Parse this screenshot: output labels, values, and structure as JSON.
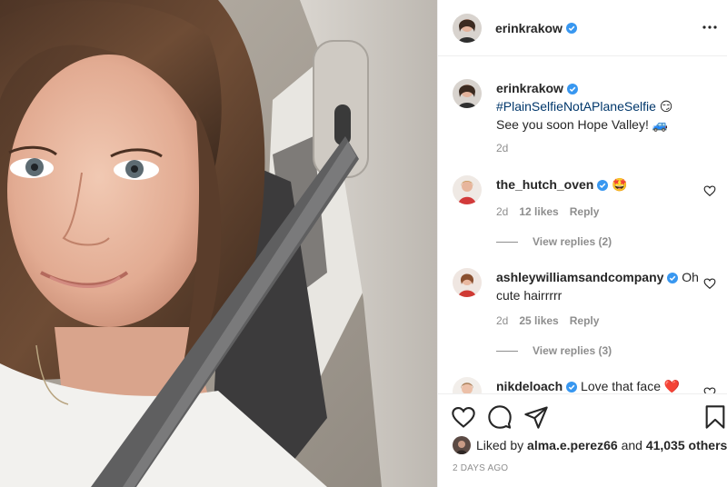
{
  "post": {
    "author": "erinkrakow",
    "caption": {
      "hashtag": "#PlainSelfieNotAPlaneSelfie",
      "hashtag_emoji": "😏",
      "text": "See you soon Hope Valley!",
      "text_emoji": "🚙",
      "age": "2d"
    }
  },
  "comments": [
    {
      "username": "the_hutch_oven",
      "text": "🤩",
      "age": "2d",
      "likes": "12 likes",
      "reply_label": "Reply",
      "view_replies": "View replies (2)"
    },
    {
      "username": "ashleywilliamsandcompany",
      "text": "Oh cute hairrrrr",
      "age": "2d",
      "likes": "25 likes",
      "reply_label": "Reply",
      "view_replies": "View replies (3)"
    },
    {
      "username": "nikdeloach",
      "text": "Love that face ❤️"
    }
  ],
  "likes": {
    "prefix": "Liked by",
    "user": "alma.e.perez66",
    "joiner": "and",
    "others": "41,035 others"
  },
  "posted": "2 DAYS AGO",
  "colors": {
    "verified": "#3897f0",
    "hashtag": "#00376b",
    "secondary_text": "#8e8e8e",
    "divider": "#efefef"
  }
}
